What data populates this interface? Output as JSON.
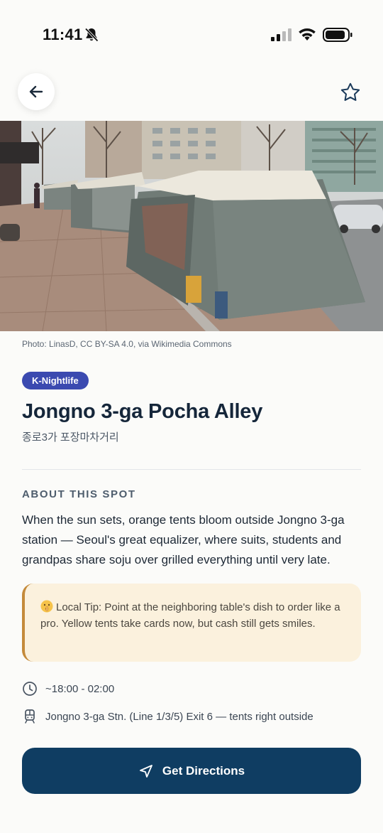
{
  "status_bar": {
    "time": "11:41",
    "icons": [
      "bell-slash-icon",
      "cellular-signal-icon",
      "wifi-icon",
      "battery-icon"
    ]
  },
  "header": {
    "back_icon": "arrow-left-icon",
    "favorite_icon": "star-outline-icon"
  },
  "photo": {
    "credit": "Photo: LinasD, CC BY-SA 4.0, via Wikimedia Commons"
  },
  "spot": {
    "category": "K-Nightlife",
    "name": "Jongno 3-ga Pocha Alley",
    "name_local": "종로3가 포장마차거리"
  },
  "about": {
    "heading": "ABOUT THIS SPOT",
    "description": "When the sun sets, orange tents bloom outside Jongno 3-ga station — Seoul's great equalizer, where suits, students and grandpas share soju over grilled everything until very late."
  },
  "tip": {
    "icon": "shushing-face-emoji",
    "text": "Local Tip: Point at the neighboring table's dish to order like a pro. Yellow tents take cards now, but cash still gets smiles."
  },
  "details": {
    "hours": "~18:00 - 02:00",
    "transit": "Jongno 3-ga Stn. (Line 1/3/5) Exit 6 — tents right outside"
  },
  "actions": {
    "directions_label": "Get Directions"
  },
  "colors": {
    "badge": "#3b4ab0",
    "primary_button": "#0f3d62",
    "tip_background": "#fbf1dd",
    "tip_accent": "#c48a3a"
  }
}
